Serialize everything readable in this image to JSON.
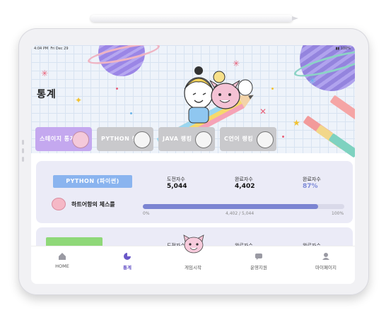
{
  "status_bar": {
    "time": "4:04 PM",
    "date": "Fri Dec 29",
    "battery": "100%"
  },
  "page": {
    "title": "통계"
  },
  "tabs": [
    {
      "label": "스테이지 통계"
    },
    {
      "label": "PYTHON 랭킹"
    },
    {
      "label": "JAVA 랭킹"
    },
    {
      "label": "C언어 랭킹"
    }
  ],
  "python_card": {
    "course_title": "PYTHON (파이썬)",
    "lesson_name": "하트어항의 체스를",
    "stats": [
      {
        "label": "도전자수",
        "value": "5,044"
      },
      {
        "label": "완료자수",
        "value": "4,402"
      },
      {
        "label": "완료자수",
        "value": "87%"
      }
    ],
    "progress": {
      "fraction": 0.87,
      "start_label": "0%",
      "mid_label": "4,402 / 5,044",
      "end_label": "100%"
    }
  },
  "second_card": {
    "stats": [
      {
        "label": "도전자수"
      },
      {
        "label": "완료자수"
      },
      {
        "label": "완료자수"
      }
    ]
  },
  "nav": [
    {
      "label": "HOME",
      "icon": "home-icon"
    },
    {
      "label": "통계",
      "icon": "stats-icon"
    },
    {
      "label": "게임시작",
      "icon": "cat-icon"
    },
    {
      "label": "운영지원",
      "icon": "chat-icon"
    },
    {
      "label": "마이페이지",
      "icon": "person-icon"
    }
  ],
  "colors": {
    "accent": "#6a58c8",
    "active_tab": "#c4a8ef",
    "inactive_tab": "#c9c9cc",
    "ribbon": "#8ab4ef",
    "ribbon_green": "#8fd879",
    "progress_fill": "#7b84d2",
    "card_bg": "#ebebf7",
    "percent_text": "#7d8ad8"
  }
}
